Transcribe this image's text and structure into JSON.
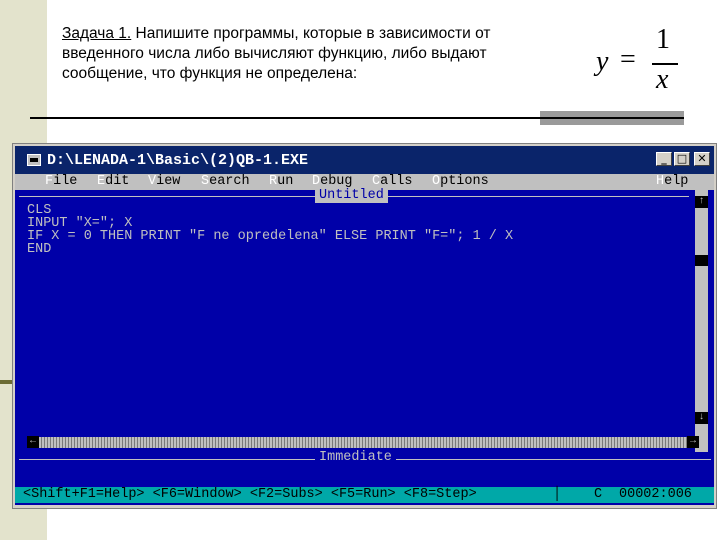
{
  "slide": {
    "task_label": "Задача 1.",
    "task_text": " Напишите программы, которые в зависимости от введенного числа либо вычисляют функцию, либо выдают сообщение, что функция не определена:",
    "formula": {
      "lhs": "y",
      "equals": "=",
      "numerator": "1",
      "denominator": "x"
    }
  },
  "window": {
    "title": "D:\\LENADA-1\\Basic\\(2)QB-1.EXE",
    "buttons": {
      "minimize": "_",
      "maximize": "□",
      "close": "✕"
    }
  },
  "menu": {
    "items": [
      {
        "hot": "F",
        "rest": "ile"
      },
      {
        "hot": "E",
        "rest": "dit"
      },
      {
        "hot": "V",
        "rest": "iew"
      },
      {
        "hot": "S",
        "rest": "earch"
      },
      {
        "hot": "R",
        "rest": "un"
      },
      {
        "hot": "D",
        "rest": "ebug"
      },
      {
        "hot": "C",
        "rest": "alls"
      },
      {
        "hot": "O",
        "rest": "ptions"
      }
    ],
    "help": {
      "hot": "H",
      "rest": "elp"
    }
  },
  "editor": {
    "document_title": "Untitled",
    "code_lines": [
      "CLS",
      "INPUT \"X=\"; X",
      "IF X = 0 THEN PRINT \"F ne opredelena\" ELSE PRINT \"F=\"; 1 / X",
      "END"
    ],
    "immediate_label": "Immediate"
  },
  "scrollbars": {
    "up": "↑",
    "down": "↓",
    "left": "←",
    "right": "→"
  },
  "statusbar": {
    "hints": "<Shift+F1=Help> <F6=Window> <F2=Subs> <F5=Run> <F8=Step>",
    "separator": "│",
    "mode": "C",
    "position": "00002:006"
  },
  "colors": {
    "titlebar": "#0a246a",
    "editor_bg": "#0000a8",
    "statusbar": "#00a8a8",
    "menubar": "#c0c0c0"
  }
}
